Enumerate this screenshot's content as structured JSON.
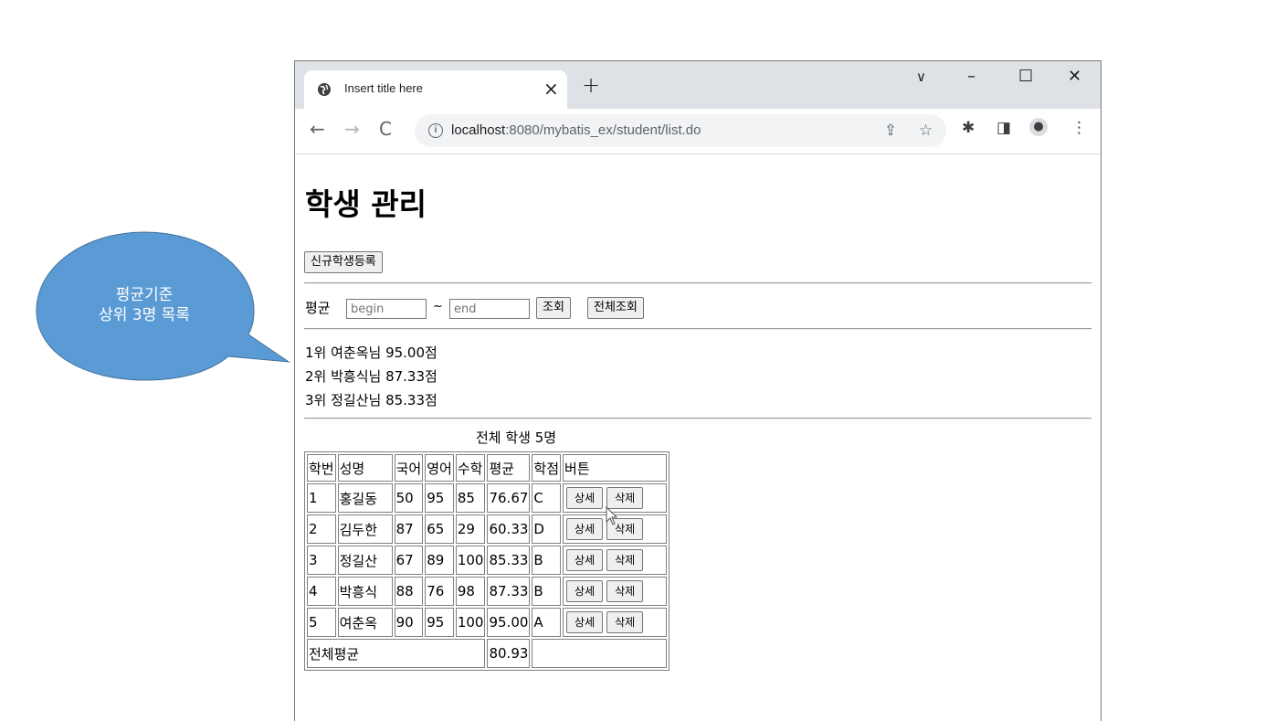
{
  "callout": {
    "line1": "평균기준",
    "line2": "상위 3명 목록",
    "color": "#5b9bd5"
  },
  "browser": {
    "tab_title": "Insert title here",
    "url_host": "localhost",
    "url_rest": ":8080/mybatis_ex/student/list.do"
  },
  "page": {
    "title": "학생 관리",
    "register_button": "신규학생등록",
    "filter": {
      "label": "평균",
      "begin_placeholder": "begin",
      "tilde": "~",
      "end_placeholder": "end",
      "search_button": "조회",
      "all_button": "전체조회"
    },
    "ranks": [
      "1위 여춘옥님 95.00점",
      "2위 박흥식님 87.33점",
      "3위 정길산님 85.33점"
    ],
    "caption": "전체 학생 5명",
    "table": {
      "headers": [
        "학번",
        "성명",
        "국어",
        "영어",
        "수학",
        "평균",
        "학점",
        "버튼"
      ],
      "rows": [
        [
          "1",
          "홍길동",
          "50",
          "95",
          "85",
          "76.67",
          "C"
        ],
        [
          "2",
          "김두한",
          "87",
          "65",
          "29",
          "60.33",
          "D"
        ],
        [
          "3",
          "정길산",
          "67",
          "89",
          "100",
          "85.33",
          "B"
        ],
        [
          "4",
          "박흥식",
          "88",
          "76",
          "98",
          "87.33",
          "B"
        ],
        [
          "5",
          "여춘옥",
          "90",
          "95",
          "100",
          "95.00",
          "A"
        ]
      ],
      "detail_button": "상세",
      "delete_button": "삭제",
      "footer_label": "전체평균",
      "footer_value": "80.93"
    }
  }
}
